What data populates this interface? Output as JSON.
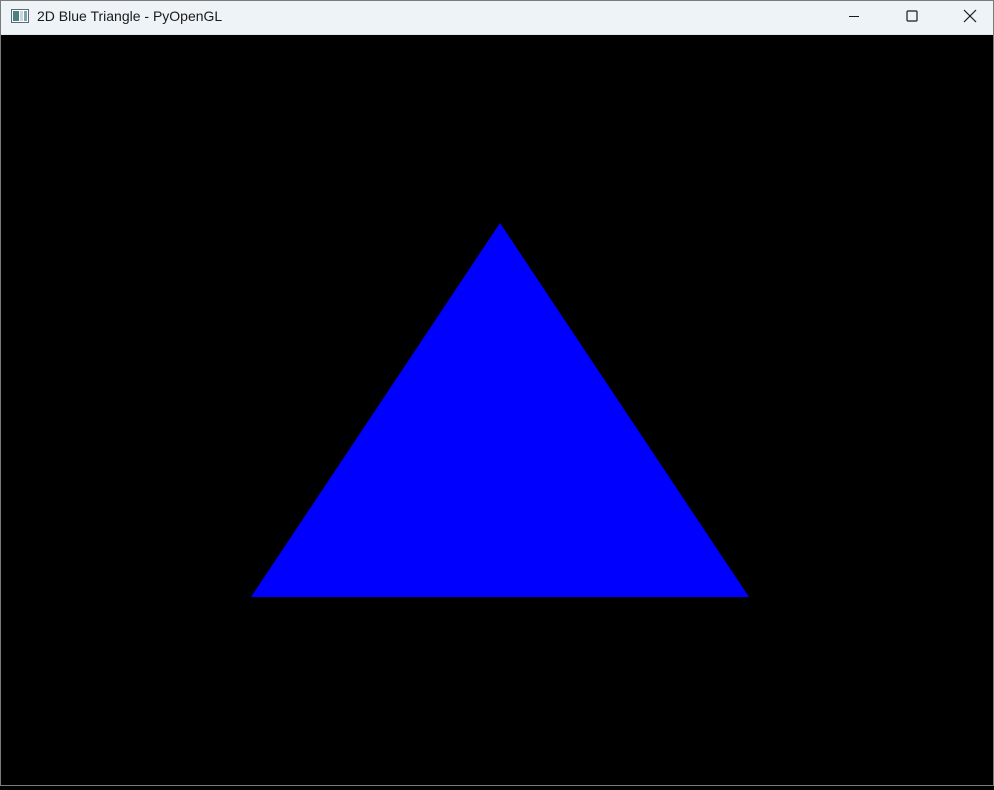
{
  "window": {
    "title": "2D Blue Triangle - PyOpenGL",
    "icon": "window-app-icon",
    "controls": {
      "minimize_icon": "minimize-icon",
      "maximize_icon": "maximize-icon",
      "close_icon": "close-icon"
    }
  },
  "scene": {
    "background_color": "#000000",
    "shape": "triangle",
    "fill_color": "#0000ff"
  },
  "colors": {
    "titlebar": "#eef3f7",
    "title_text": "#1a1a1a",
    "canvas_bg": "#000000",
    "triangle": "#0000ff"
  }
}
